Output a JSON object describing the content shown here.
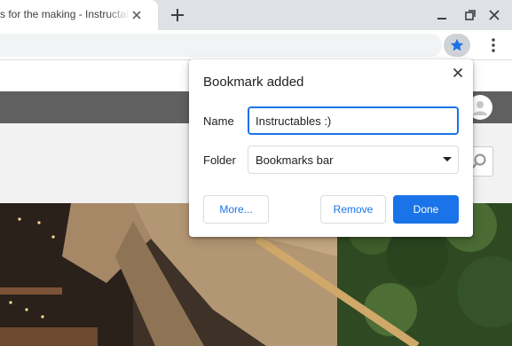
{
  "browser": {
    "tab_title": "s for the making - Instructables",
    "colors": {
      "accent": "#1a73e8",
      "tabstrip": "#dee1e6",
      "toolbar_star_bg": "#cfd2d6"
    },
    "icons": [
      "close-icon",
      "plus-icon",
      "minimize-icon",
      "restore-icon",
      "close-icon",
      "star-icon",
      "more-vert-icon"
    ]
  },
  "page": {
    "colors": {
      "nav_bar": "#606060",
      "header_bg": "#f2f2f2"
    },
    "icons": [
      "avatar-icon",
      "search-icon"
    ]
  },
  "bookmark_bubble": {
    "title": "Bookmark added",
    "name_label": "Name",
    "name_value": "Instructables :)",
    "folder_label": "Folder",
    "folder_value": "Bookmarks bar",
    "more_button": "More...",
    "remove_button": "Remove",
    "done_button": "Done"
  }
}
